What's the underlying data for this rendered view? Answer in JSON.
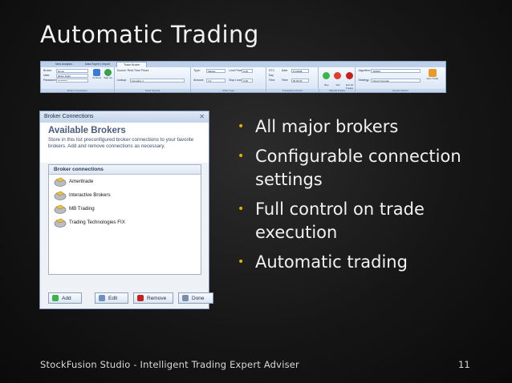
{
  "slide": {
    "title": "Automatic Trading",
    "footer": "StockFusion Studio - Intelligent Trading Expert Adviser",
    "page_number": "11",
    "bullets": [
      "All major brokers",
      "Configurable connection settings",
      "Full control on trade execution",
      "Automatic trading"
    ]
  },
  "ribbon": {
    "tabs": [
      "New Analysis",
      "Data Expert | Import",
      "Trade Broker"
    ],
    "active_tab": "Trade Broker",
    "broker": {
      "broker_label": "Broker:",
      "broker_value": "Demo",
      "user_label": "User:",
      "user_value": "[Enter login]",
      "password_label": "Password:",
      "password_value": "**********",
      "connect_label": "Connect",
      "signup_label": "Sign Up"
    },
    "source": {
      "label": "Source: Real-Time Prices",
      "lookup_label": "Lookup:",
      "lookup_value": "Company 1"
    },
    "order": {
      "type_label": "Type:",
      "type_value": "Market",
      "amount_label": "Amount:",
      "amount_value": "1.0",
      "limit_label": "Limit Price:",
      "limit_value": "0.00",
      "stop_label": "Stop Loss:",
      "stop_value": "0.00"
    },
    "time": {
      "gtc": "GTC",
      "day": "Day",
      "time_opt": "Time",
      "date_label": "Date:",
      "date_value": "1/1/2008",
      "time_label": "Time:",
      "time_value": "00:00:00"
    },
    "actions": {
      "buy": "Buy",
      "sell": "Sell",
      "exit": "Exit All Trades"
    },
    "algo": {
      "algorithm_label": "Algorithm:",
      "algorithm_value": "ARIMA",
      "strategy_label": "Strategy:",
      "strategy_value": "Direct Forecast",
      "auto_label": "Auto Trade"
    },
    "footer_groups": [
      "Broker Connection",
      "Stock Symbol",
      "Order Type",
      "Transaction Period",
      "Manual Trades",
      "Expert Advisor"
    ]
  },
  "dialog": {
    "title": "Broker Connections",
    "heading": "Available Brokers",
    "description": "Store in this list preconfigured broker connections to your favorite brokers. Add and remove connections as necessary.",
    "list_header": "Broker connections",
    "brokers": [
      "Ameritrade",
      "Interactive Brokers",
      "MB Trading",
      "Trading Technologies FIX"
    ],
    "buttons": {
      "add": "Add",
      "edit": "Edit",
      "remove": "Remove",
      "done": "Done"
    }
  },
  "colors": {
    "bullet": "#e3b100",
    "text": "#f2f2f2",
    "background": "#1a1a1a"
  }
}
